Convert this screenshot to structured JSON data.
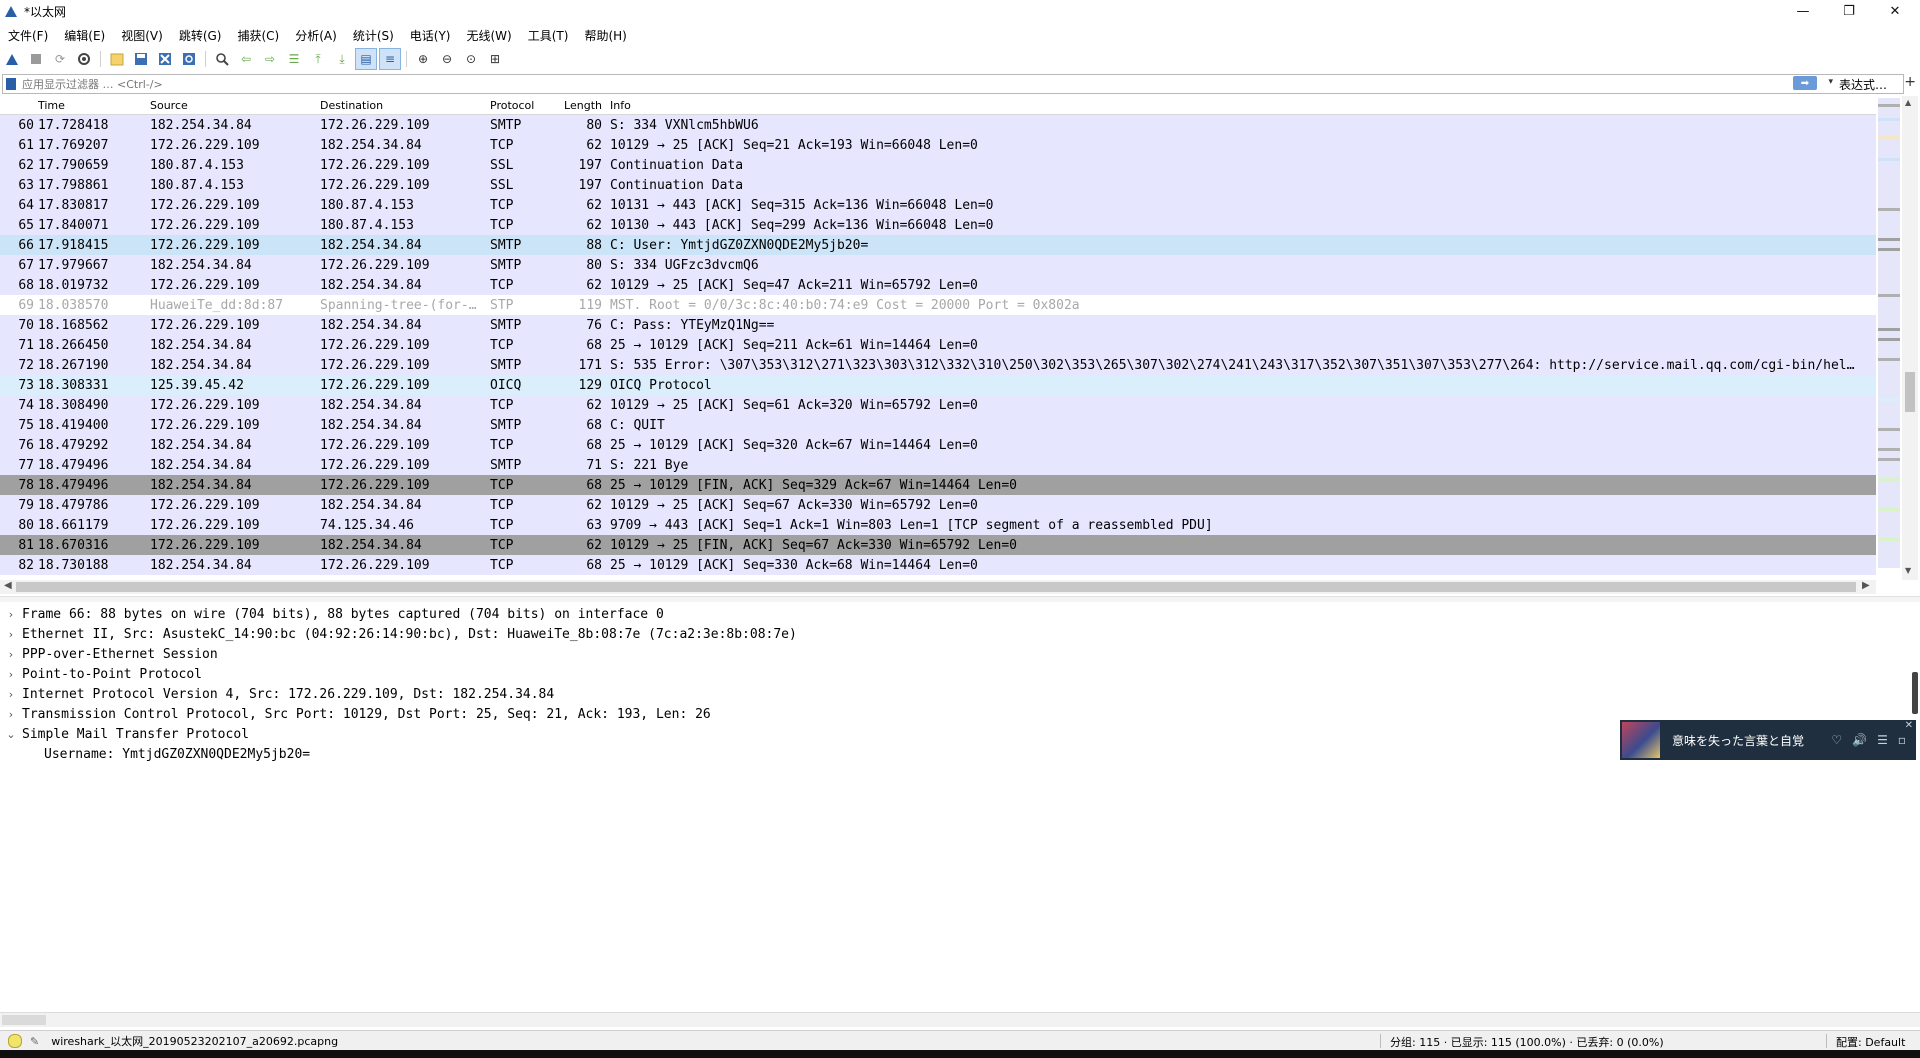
{
  "window": {
    "title": "*以太网"
  },
  "menu": [
    "文件(F)",
    "编辑(E)",
    "视图(V)",
    "跳转(G)",
    "捕获(C)",
    "分析(A)",
    "统计(S)",
    "电话(Y)",
    "无线(W)",
    "工具(T)",
    "帮助(H)"
  ],
  "filter": {
    "placeholder": "应用显示过滤器 … <Ctrl-/>",
    "expression_label": "表达式…",
    "add_label": "+"
  },
  "columns": {
    "no": "",
    "time": "Time",
    "source": "Source",
    "destination": "Destination",
    "protocol": "Protocol",
    "length": "Length",
    "info": "Info"
  },
  "packets": [
    {
      "no": "60",
      "time": "17.728418",
      "source": "182.254.34.84",
      "destination": "172.26.229.109",
      "protocol": "SMTP",
      "length": "80",
      "info": "S: 334 VXNlcm5hbWU6"
    },
    {
      "no": "61",
      "time": "17.769207",
      "source": "172.26.229.109",
      "destination": "182.254.34.84",
      "protocol": "TCP",
      "length": "62",
      "info": "10129 → 25 [ACK] Seq=21 Ack=193 Win=66048 Len=0"
    },
    {
      "no": "62",
      "time": "17.790659",
      "source": "180.87.4.153",
      "destination": "172.26.229.109",
      "protocol": "SSL",
      "length": "197",
      "info": "Continuation Data"
    },
    {
      "no": "63",
      "time": "17.798861",
      "source": "180.87.4.153",
      "destination": "172.26.229.109",
      "protocol": "SSL",
      "length": "197",
      "info": "Continuation Data"
    },
    {
      "no": "64",
      "time": "17.830817",
      "source": "172.26.229.109",
      "destination": "180.87.4.153",
      "protocol": "TCP",
      "length": "62",
      "info": "10131 → 443 [ACK] Seq=315 Ack=136 Win=66048 Len=0"
    },
    {
      "no": "65",
      "time": "17.840071",
      "source": "172.26.229.109",
      "destination": "180.87.4.153",
      "protocol": "TCP",
      "length": "62",
      "info": "10130 → 443 [ACK] Seq=299 Ack=136 Win=66048 Len=0"
    },
    {
      "no": "66",
      "time": "17.918415",
      "source": "172.26.229.109",
      "destination": "182.254.34.84",
      "protocol": "SMTP",
      "length": "88",
      "info": "C: User: YmtjdGZ0ZXN0QDE2My5jb20=",
      "state": "selected"
    },
    {
      "no": "67",
      "time": "17.979667",
      "source": "182.254.34.84",
      "destination": "172.26.229.109",
      "protocol": "SMTP",
      "length": "80",
      "info": "S: 334 UGFzc3dvcmQ6"
    },
    {
      "no": "68",
      "time": "18.019732",
      "source": "172.26.229.109",
      "destination": "182.254.34.84",
      "protocol": "TCP",
      "length": "62",
      "info": "10129 → 25 [ACK] Seq=47 Ack=211 Win=65792 Len=0"
    },
    {
      "no": "69",
      "time": "18.038570",
      "source": "HuaweiTe_dd:8d:87",
      "destination": "Spanning-tree-(for-…",
      "protocol": "STP",
      "length": "119",
      "info": "MST. Root = 0/0/3c:8c:40:b0:74:e9  Cost = 20000  Port = 0x802a"
    },
    {
      "no": "70",
      "time": "18.168562",
      "source": "172.26.229.109",
      "destination": "182.254.34.84",
      "protocol": "SMTP",
      "length": "76",
      "info": "C: Pass: YTEyMzQ1Ng=="
    },
    {
      "no": "71",
      "time": "18.266450",
      "source": "182.254.34.84",
      "destination": "172.26.229.109",
      "protocol": "TCP",
      "length": "68",
      "info": "25 → 10129 [ACK] Seq=211 Ack=61 Win=14464 Len=0"
    },
    {
      "no": "72",
      "time": "18.267190",
      "source": "182.254.34.84",
      "destination": "172.26.229.109",
      "protocol": "SMTP",
      "length": "171",
      "info": "S: 535 Error: \\307\\353\\312\\271\\323\\303\\312\\332\\310\\250\\302\\353\\265\\307\\302\\274\\241\\243\\317\\352\\307\\351\\307\\353\\277\\264: http://service.mail.qq.com/cgi-bin/hel…"
    },
    {
      "no": "73",
      "time": "18.308331",
      "source": "125.39.45.42",
      "destination": "172.26.229.109",
      "protocol": "OICQ",
      "length": "129",
      "info": "OICQ Protocol"
    },
    {
      "no": "74",
      "time": "18.308490",
      "source": "172.26.229.109",
      "destination": "182.254.34.84",
      "protocol": "TCP",
      "length": "62",
      "info": "10129 → 25 [ACK] Seq=61 Ack=320 Win=65792 Len=0"
    },
    {
      "no": "75",
      "time": "18.419400",
      "source": "172.26.229.109",
      "destination": "182.254.34.84",
      "protocol": "SMTP",
      "length": "68",
      "info": "C: QUIT"
    },
    {
      "no": "76",
      "time": "18.479292",
      "source": "182.254.34.84",
      "destination": "172.26.229.109",
      "protocol": "TCP",
      "length": "68",
      "info": "25 → 10129 [ACK] Seq=320 Ack=67 Win=14464 Len=0"
    },
    {
      "no": "77",
      "time": "18.479496",
      "source": "182.254.34.84",
      "destination": "172.26.229.109",
      "protocol": "SMTP",
      "length": "71",
      "info": "S: 221 Bye"
    },
    {
      "no": "78",
      "time": "18.479496",
      "source": "182.254.34.84",
      "destination": "172.26.229.109",
      "protocol": "TCP",
      "length": "68",
      "info": "25 → 10129 [FIN, ACK] Seq=329 Ack=67 Win=14464 Len=0",
      "state": "finack"
    },
    {
      "no": "79",
      "time": "18.479786",
      "source": "172.26.229.109",
      "destination": "182.254.34.84",
      "protocol": "TCP",
      "length": "62",
      "info": "10129 → 25 [ACK] Seq=67 Ack=330 Win=65792 Len=0"
    },
    {
      "no": "80",
      "time": "18.661179",
      "source": "172.26.229.109",
      "destination": "74.125.34.46",
      "protocol": "TCP",
      "length": "63",
      "info": "9709 → 443 [ACK] Seq=1 Ack=1 Win=803 Len=1 [TCP segment of a reassembled PDU]"
    },
    {
      "no": "81",
      "time": "18.670316",
      "source": "172.26.229.109",
      "destination": "182.254.34.84",
      "protocol": "TCP",
      "length": "62",
      "info": "10129 → 25 [FIN, ACK] Seq=67 Ack=330 Win=65792 Len=0",
      "state": "finack"
    },
    {
      "no": "82",
      "time": "18.730188",
      "source": "182.254.34.84",
      "destination": "172.26.229.109",
      "protocol": "TCP",
      "length": "68",
      "info": "25 → 10129 [ACK] Seq=330 Ack=68 Win=14464 Len=0"
    }
  ],
  "details": [
    {
      "arrow": "›",
      "text": "Frame 66: 88 bytes on wire (704 bits), 88 bytes captured (704 bits) on interface 0"
    },
    {
      "arrow": "›",
      "text": "Ethernet II, Src: AsustekC_14:90:bc (04:92:26:14:90:bc), Dst: HuaweiTe_8b:08:7e (7c:a2:3e:8b:08:7e)"
    },
    {
      "arrow": "›",
      "text": "PPP-over-Ethernet Session"
    },
    {
      "arrow": "›",
      "text": "Point-to-Point Protocol"
    },
    {
      "arrow": "›",
      "text": "Internet Protocol Version 4, Src: 172.26.229.109, Dst: 182.254.34.84"
    },
    {
      "arrow": "›",
      "text": "Transmission Control Protocol, Src Port: 10129, Dst Port: 25, Seq: 21, Ack: 193, Len: 26"
    },
    {
      "arrow": "⌄",
      "text": "Simple Mail Transfer Protocol"
    }
  ],
  "detail_sub": "Username: YmtjdGZ0ZXN0QDE2My5jb20=",
  "media_popup": {
    "song": "意味を失った言葉と自覚",
    "close": "✕"
  },
  "status": {
    "file": "wireshark_以太网_20190523202107_a20692.pcapng",
    "stats": "分组: 115 · 已显示: 115 (100.0%) · 已丢弃: 0 (0.0%)",
    "profile": "配置: Default"
  },
  "colors": {
    "smtp_tcp_row": "#e7e6ff",
    "oicq_row": "#daeefb",
    "selected_row": "#cce4f7",
    "finack_row": "#a0a0a0"
  }
}
